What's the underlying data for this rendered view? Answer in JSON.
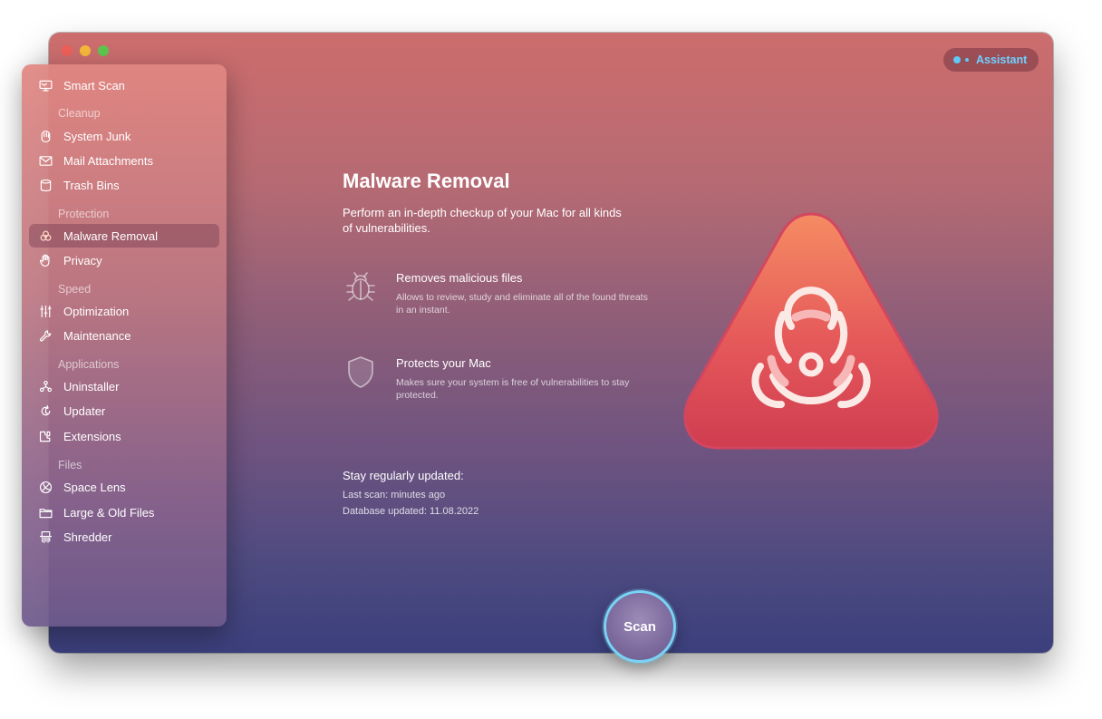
{
  "window": {
    "traffic_lights": [
      "close",
      "minimize",
      "zoom"
    ]
  },
  "assistant": {
    "label": "Assistant"
  },
  "sidebar": {
    "top_item": {
      "label": "Smart Scan",
      "icon": "monitor-icon"
    },
    "sections": [
      {
        "heading": "Cleanup",
        "items": [
          {
            "label": "System Junk",
            "icon": "system-junk-icon"
          },
          {
            "label": "Mail Attachments",
            "icon": "mail-icon"
          },
          {
            "label": "Trash Bins",
            "icon": "trash-icon"
          }
        ]
      },
      {
        "heading": "Protection",
        "items": [
          {
            "label": "Malware Removal",
            "icon": "biohazard-icon",
            "active": true
          },
          {
            "label": "Privacy",
            "icon": "hand-icon"
          }
        ]
      },
      {
        "heading": "Speed",
        "items": [
          {
            "label": "Optimization",
            "icon": "sliders-icon"
          },
          {
            "label": "Maintenance",
            "icon": "wrench-icon"
          }
        ]
      },
      {
        "heading": "Applications",
        "items": [
          {
            "label": "Uninstaller",
            "icon": "uninstaller-icon"
          },
          {
            "label": "Updater",
            "icon": "updater-icon"
          },
          {
            "label": "Extensions",
            "icon": "extensions-icon"
          }
        ]
      },
      {
        "heading": "Files",
        "items": [
          {
            "label": "Space Lens",
            "icon": "space-lens-icon"
          },
          {
            "label": "Large & Old Files",
            "icon": "folder-icon"
          },
          {
            "label": "Shredder",
            "icon": "shredder-icon"
          }
        ]
      }
    ]
  },
  "main": {
    "title": "Malware Removal",
    "description": "Perform an in-depth checkup of your Mac for all kinds of vulnerabilities.",
    "features": [
      {
        "title": "Removes malicious files",
        "description": "Allows to review, study and eliminate all of the found threats in an instant.",
        "icon": "bug-icon"
      },
      {
        "title": "Protects your Mac",
        "description": "Makes sure your system is free of vulnerabilities to stay protected.",
        "icon": "shield-icon"
      }
    ],
    "updates_heading": "Stay regularly updated:",
    "last_scan": "Last scan: minutes ago",
    "database_updated": "Database updated: 11.08.2022"
  },
  "scan_button": {
    "label": "Scan"
  },
  "colors": {
    "accent": "#79d3f5",
    "assistant_text": "#6fd0ff",
    "hero_top": "#f28a64",
    "hero_bottom": "#d9444f"
  }
}
